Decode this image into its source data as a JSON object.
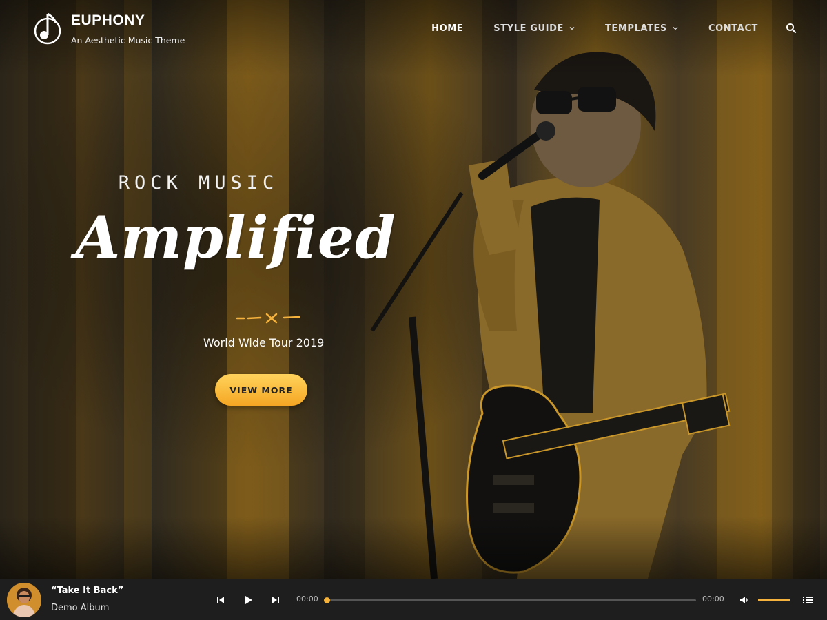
{
  "site": {
    "title": "EUPHONY",
    "tagline": "An Aesthetic Music Theme",
    "logo_icon": "music-note-icon"
  },
  "nav": {
    "items": [
      {
        "label": "HOME",
        "active": true,
        "dropdown": false
      },
      {
        "label": "STYLE GUIDE",
        "active": false,
        "dropdown": true
      },
      {
        "label": "TEMPLATES",
        "active": false,
        "dropdown": true
      },
      {
        "label": "CONTACT",
        "active": false,
        "dropdown": false
      }
    ],
    "search_icon": "search-icon"
  },
  "hero": {
    "kicker": "ROCK MUSIC",
    "headline": "Amplified",
    "subtitle": "World Wide Tour 2019",
    "button_label": "VIEW MORE",
    "accent_color": "#f5b23c",
    "tint_color": "#e0a020"
  },
  "player": {
    "track_title": "“Take It Back”",
    "album": "Demo Album",
    "current_time": "00:00",
    "duration": "00:00",
    "progress": 0,
    "volume": 1.0,
    "icons": [
      "previous-icon",
      "play-icon",
      "next-icon",
      "volume-icon",
      "playlist-icon"
    ]
  }
}
